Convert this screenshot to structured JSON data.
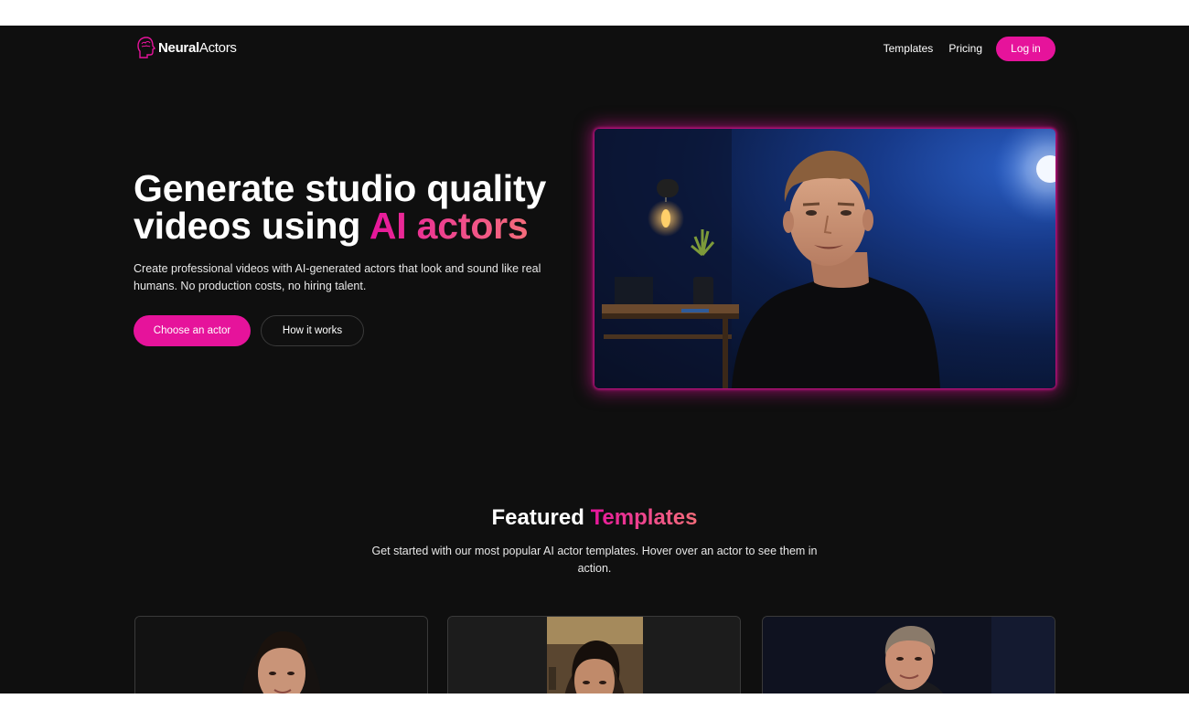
{
  "brand": {
    "name_bold": "Neural",
    "name_regular": "Actors",
    "accent": "#e6139b"
  },
  "nav": {
    "links": [
      "Templates",
      "Pricing"
    ],
    "login_label": "Log in"
  },
  "hero": {
    "title_line1": "Generate studio quality",
    "title_line2_plain": "videos using ",
    "title_line2_accent": "AI actors",
    "subtitle": "Create professional videos with AI-generated actors that look and sound like real humans. No production costs, no hiring talent.",
    "primary_cta": "Choose an actor",
    "secondary_cta": "How it works"
  },
  "featured": {
    "title_plain": "Featured ",
    "title_accent": "Templates",
    "subtitle": "Get started with our most popular AI actor templates. Hover over an actor to see them in action."
  }
}
